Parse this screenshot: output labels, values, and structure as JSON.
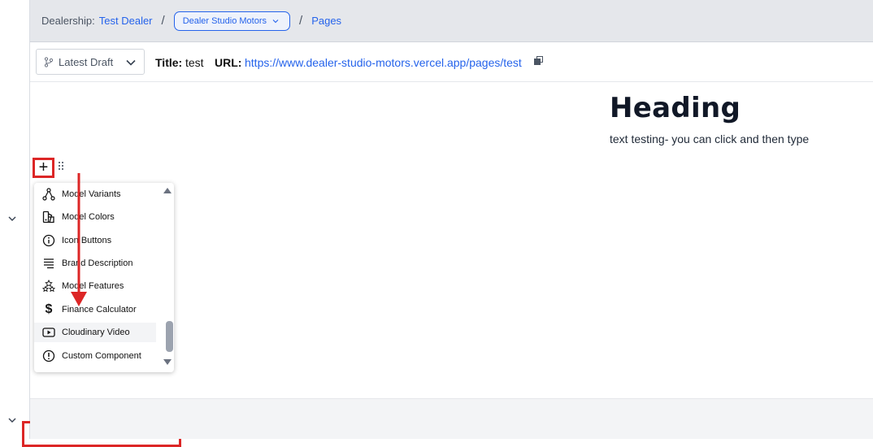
{
  "breadcrumb": {
    "dealership_label": "Dealership:",
    "dealership_link": "Test Dealer",
    "separator": "/",
    "dealer_select": "Dealer Studio Motors",
    "pages_link": "Pages"
  },
  "toolbar": {
    "draft_select": "Latest Draft",
    "title_label": "Title:",
    "title_value": "test",
    "url_label": "URL:",
    "url_value": "https://www.dealer-studio-motors.vercel.app/pages/test"
  },
  "content": {
    "heading": "Heading",
    "text": "text testing- you can click and then type"
  },
  "add_button": "+",
  "component_menu": {
    "items": [
      {
        "label": "Model Variants",
        "icon": "hierarchy-icon"
      },
      {
        "label": "Model Colors",
        "icon": "swatch-icon"
      },
      {
        "label": "Icon Buttons",
        "icon": "info-circle-icon"
      },
      {
        "label": "Brand Description",
        "icon": "text-lines-icon"
      },
      {
        "label": "Model Features",
        "icon": "stars-icon"
      },
      {
        "label": "Finance Calculator",
        "icon": "dollar-icon"
      },
      {
        "label": "Cloudinary Video",
        "icon": "video-play-icon"
      },
      {
        "label": "Custom Component",
        "icon": "exclamation-circle-icon"
      }
    ]
  },
  "colors": {
    "accent": "#2563eb",
    "highlight": "#dc2626",
    "topbar_bg": "#e5e7eb"
  }
}
